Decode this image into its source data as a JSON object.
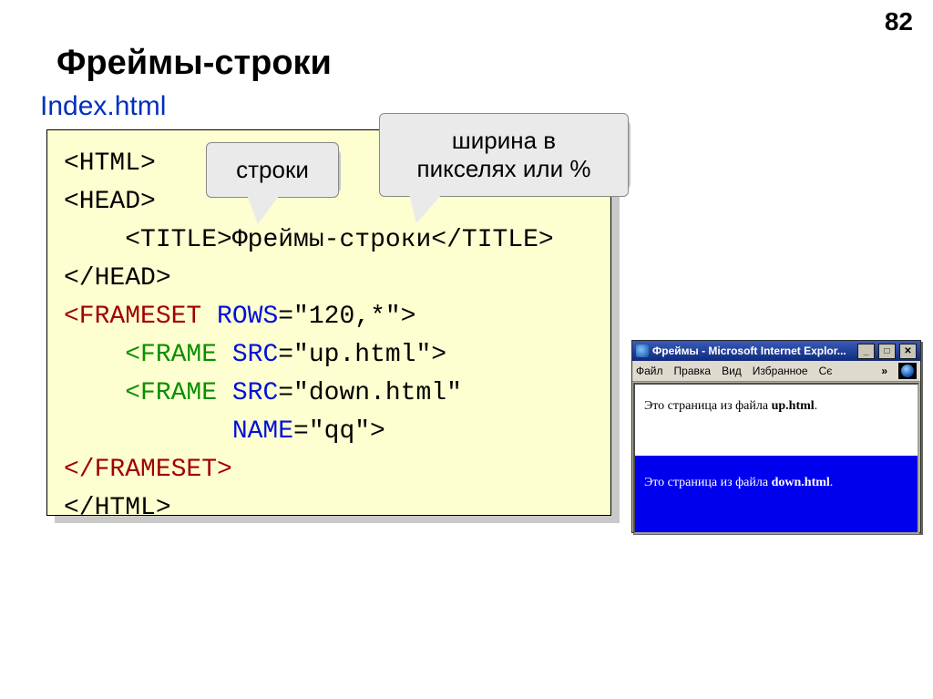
{
  "page_number": "82",
  "title": "Фреймы-строки",
  "subtitle": "Index.html",
  "callouts": {
    "rows": "строки",
    "width": "ширина в\nпикселях или %"
  },
  "code": {
    "l1": "<HTML>",
    "l2": "<HEAD>",
    "l3_a": "    <TITLE>",
    "l3_b": "Фреймы-строки",
    "l3_c": "</TITLE>",
    "l4": "</HEAD>",
    "l5_tag_open": "<FRAMESET",
    "l5_attr": " ROWS",
    "l5_val": "=\"120,*\">",
    "l6_tag_open": "    <FRAME",
    "l6_attr": " SRC",
    "l6_val": "=\"up.html\">",
    "l7_tag_open": "    <FRAME",
    "l7_attr": " SRC",
    "l7_val": "=\"down.html\"",
    "l8_attr": "           NAME",
    "l8_val": "=\"qq\">",
    "l9": "</FRAMESET>",
    "l10": "</HTML>"
  },
  "browser": {
    "title": "Фреймы - Microsoft Internet Explor...",
    "min": "_",
    "max": "□",
    "close": "✕",
    "menu": {
      "file": "Файл",
      "edit": "Правка",
      "view": "Вид",
      "fav": "Избранное",
      "more": "Сє",
      "chev": "»"
    },
    "frame_up_a": "Это страница из файла ",
    "frame_up_b": "up.html",
    "frame_up_c": ".",
    "frame_down_a": "Это страница из файла ",
    "frame_down_b": "down.html",
    "frame_down_c": "."
  }
}
